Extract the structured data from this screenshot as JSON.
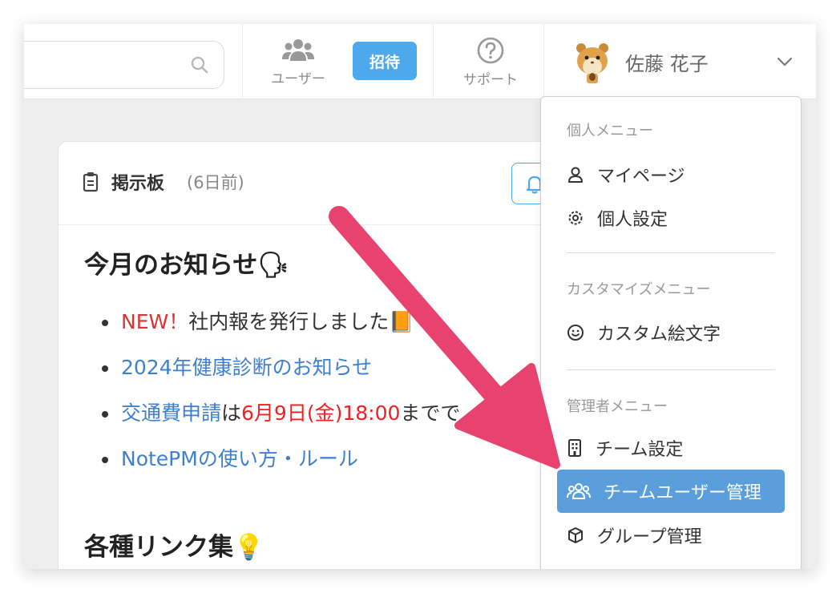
{
  "header": {
    "users_label": "ユーザー",
    "invite_label": "招待",
    "support_label": "サポート",
    "user_name": "佐藤 花子"
  },
  "board": {
    "title": "掲示板",
    "ago": "(6日前)",
    "heading1": "今月のお知らせ🗣",
    "notes": {
      "n1_new": "NEW！",
      "n1_text": "社内報を発行しました📙",
      "n2_link": "2024年健康診断のお知らせ",
      "n3_link": "交通費申請",
      "n3_mid": "は",
      "n3_date": "6月9日(金)18:00",
      "n3_tail": "までで",
      "n4_link": "NotePMの使い方・ルール"
    },
    "heading2": "各種リンク集💡"
  },
  "menu": {
    "personal_header": "個人メニュー",
    "mypage": "マイページ",
    "personal_settings": "個人設定",
    "customize_header": "カスタマイズメニュー",
    "custom_emoji": "カスタム絵文字",
    "admin_header": "管理者メニュー",
    "team_settings": "チーム設定",
    "team_user_admin": "チームユーザー管理",
    "group_admin": "グループ管理"
  },
  "colors": {
    "accent": "#4ea8ec",
    "active_menu": "#5a9fdc",
    "arrow": "#e8426e",
    "link": "#3d7fd0",
    "alert_red": "#d33"
  }
}
